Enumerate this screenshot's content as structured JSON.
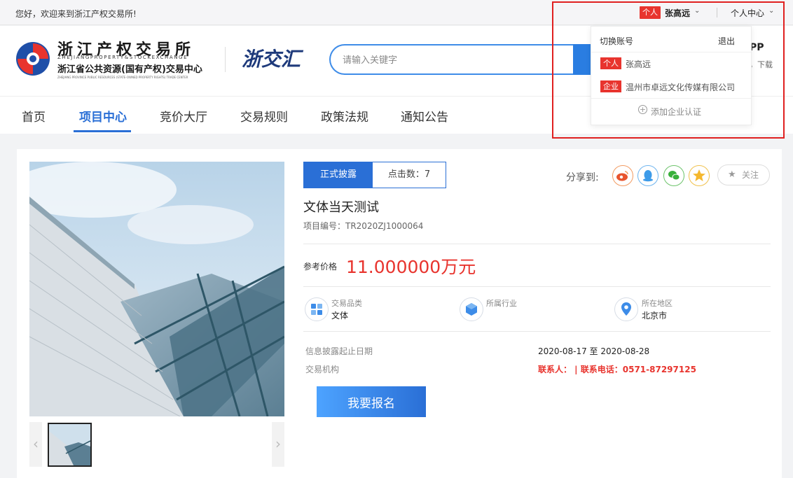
{
  "topbar": {
    "welcome": "您好，欢迎来到浙江产权交易所!",
    "user_type": "个人",
    "user_name": "张高远",
    "personal_center": "个人中心"
  },
  "header": {
    "logo_cn": "浙江产权交易所",
    "logo_en": "ZHEJIANGPROPERTY&STOCKEXCHANGE",
    "logo_sub": "浙江省公共资源(国有产权)交易中心",
    "logo_sub_en": "ZHEJIANG PROVINCE PUBLIC RESOURCES (STATE-OWNED PROPERTY RIGHTS) TRADE CENTER",
    "brand2": "浙交汇",
    "search_placeholder": "请输入关键字",
    "app_text": "PP",
    "app_download": "，下载"
  },
  "nav": {
    "items": [
      "首页",
      "项目中心",
      "竞价大厅",
      "交易规则",
      "政策法规",
      "通知公告"
    ],
    "active": "项目中心"
  },
  "dropdown": {
    "switch_account": "切换账号",
    "logout": "退出",
    "accounts": [
      {
        "tag": "个人",
        "name": "张高远"
      },
      {
        "tag": "企业",
        "name": "温州市卓远文化传媒有限公司"
      }
    ],
    "add_enterprise": "添加企业认证"
  },
  "project": {
    "tab_active": "正式披露",
    "click_count": "点击数：7",
    "share_label": "分享到:",
    "follow": "关注",
    "title": "文体当天测试",
    "number": "项目编号：TR2020ZJ1000064",
    "price_label": "参考价格",
    "price": "11.000000万元",
    "attrs": [
      {
        "key": "交易品类",
        "value": "文体"
      },
      {
        "key": "所属行业",
        "value": ""
      },
      {
        "key": "所在地区",
        "value": "北京市"
      }
    ],
    "disclosure_label": "信息披露起止日期",
    "disclosure_value": "2020-08-17  至  2020-08-28",
    "org_label": "交易机构",
    "contact": "联系人：  | 联系电话：0571-87297125",
    "apply": "我要报名"
  },
  "colors": {
    "primary": "#2a6fd6",
    "accent_red": "#e8342e",
    "highlight_box": "#e02020"
  },
  "icons": [
    "weibo-icon",
    "qq-icon",
    "wechat-icon",
    "qzone-icon",
    "star-icon",
    "category-icon",
    "industry-icon",
    "location-icon",
    "add-circle-icon"
  ]
}
